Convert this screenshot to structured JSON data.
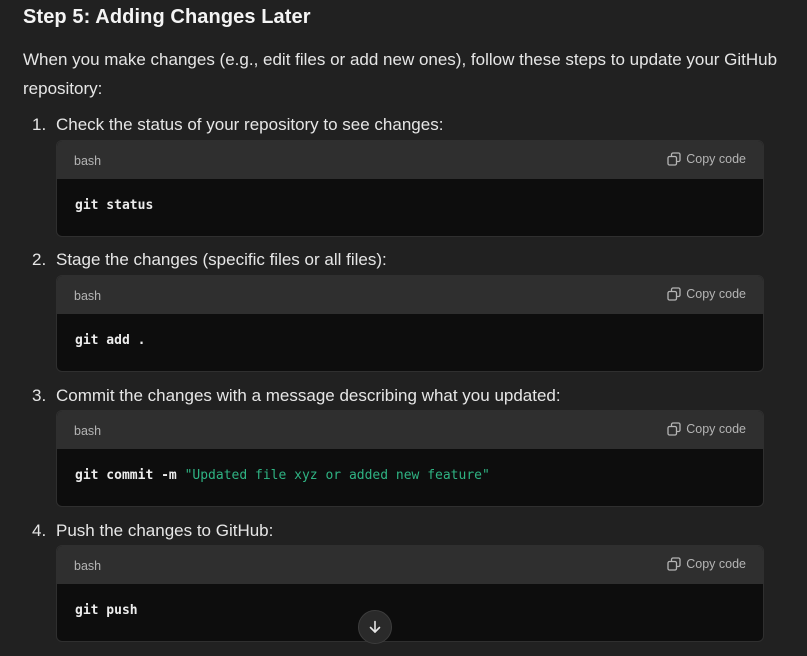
{
  "heading": "Step 5: Adding Changes Later",
  "intro": "When you make changes (e.g., edit files or add new ones), follow these steps to update your GitHub repository:",
  "steps": [
    {
      "number": "1.",
      "text": "Check the status of your repository to see changes:",
      "lang": "bash",
      "copy_label": "Copy code",
      "code": "git status",
      "code_string": ""
    },
    {
      "number": "2.",
      "text": "Stage the changes (specific files or all files):",
      "lang": "bash",
      "copy_label": "Copy code",
      "code": "git add .",
      "code_string": ""
    },
    {
      "number": "3.",
      "text": "Commit the changes with a message describing what you updated:",
      "lang": "bash",
      "copy_label": "Copy code",
      "code": "git commit -m ",
      "code_string": "\"Updated file xyz or added new feature\""
    },
    {
      "number": "4.",
      "text": "Push the changes to GitHub:",
      "lang": "bash",
      "copy_label": "Copy code",
      "code": "git push",
      "code_string": ""
    }
  ],
  "icons": {
    "copy": "copy-icon",
    "scroll": "arrow-down-icon"
  },
  "colors": {
    "background": "#212121",
    "code_background": "#0d0d0d",
    "code_header": "#2f2f2f",
    "string": "#2fb383"
  }
}
